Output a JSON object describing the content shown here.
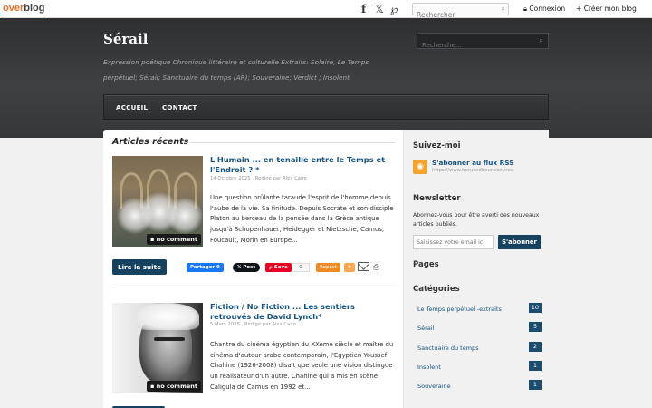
{
  "overblog": {
    "logo_part1": "over",
    "logo_part2": "blog",
    "social": [
      "facebook-icon",
      "x-icon",
      "pinterest-icon"
    ],
    "search_placeholder": "Rechercher",
    "login_label": "Connexion",
    "create_blog_label": "Créer mon blog"
  },
  "header": {
    "title": "Sérail",
    "description": "Expression poétique Chronique littéraire et culturelle Extraits: Solaire, Le Temps perpétuel; Sérail; Sanctuaire du temps (AR); Souveraine; Verdict ; Insolent",
    "search_placeholder": "Recherche...",
    "nav": [
      "ACCUEIL",
      "CONTACT"
    ]
  },
  "main": {
    "section_title": "Articles récents",
    "posts": [
      {
        "title": "L'Humain ... en tenaille entre le Temps et l'Endroit ? *",
        "meta": "14 Octobre 2025 , Rédigé par Alex Caire",
        "excerpt": "Une question brûlante taraude l'esprit de l'homme depuis l'aube de la vie. Sa finitude. Depuis Socrate et son disciple Platon au berceau de la pensée dans la Grèce antique jusqu'à Schopenhauer, Heidegger et Nietzsche, Camus, Foucault, Morin en Europe...",
        "comment_badge": "no comment"
      },
      {
        "title": "Fiction / No Fiction ... Les sentiers retrouvés de David Lynch*",
        "meta": "5 Mars 2025 , Rédigé par Alex Caire",
        "excerpt": "Chantre du cinéma égyptien du XXème siècle et maître du cinéma d'auteur arabe contemporain, l'Egyptien Youssef Chahine (1926-2008) disait que seule une vision distingue un réalisateur d'un autre. Chahine qui a mis en scène Caligula de Camus en 1992 et...",
        "comment_badge": "no comment"
      }
    ],
    "share": {
      "read_more": "Lire la suite",
      "facebook": "Partager",
      "facebook_count": "0",
      "x_post": "Post",
      "pinterest": "Save",
      "pinterest_count": "0",
      "repost": "Repost",
      "repost_count": "0"
    }
  },
  "sidebar": {
    "follow_title": "Suivez-moi",
    "rss_title": "S'abonner au flux RSS",
    "rss_url": "https://www.horusediteur.com/rss",
    "newsletter_title": "Newsletter",
    "newsletter_text": "Abonnez-vous pour être averti des nouveaux articles publiés.",
    "newsletter_placeholder": "Saisissez votre email ici",
    "newsletter_button": "S'abonner",
    "pages_title": "Pages",
    "categories_title": "Catégories",
    "categories": [
      {
        "label": "Le Temps perpétuel -extraits",
        "count": "10"
      },
      {
        "label": "Sérail",
        "count": "5"
      },
      {
        "label": "Sanctuaire du temps",
        "count": "2"
      },
      {
        "label": "Insolent",
        "count": "1"
      },
      {
        "label": "Souveraine",
        "count": "1"
      }
    ]
  },
  "colors": {
    "brand_orange": "#e8732b",
    "link_blue": "#15527f",
    "button_navy": "#17425f",
    "header_dark": "#3a3b3d"
  }
}
